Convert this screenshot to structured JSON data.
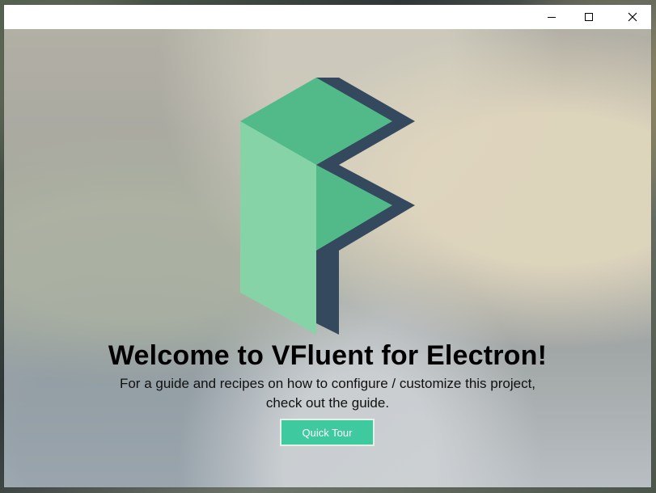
{
  "window": {
    "controls": {
      "minimize": "minimize-icon",
      "maximize": "maximize-icon",
      "close": "close-icon"
    }
  },
  "brand": {
    "logo_icon": "vfluent-logo-icon"
  },
  "main": {
    "headline": "Welcome to VFluent for Electron!",
    "subtitle": "For a guide and recipes on how to configure / customize this project, check out the guide.",
    "cta_label": "Quick Tour"
  },
  "colors": {
    "logo_light": "#86d3a8",
    "logo_mid": "#52ba88",
    "logo_dark": "#34495e",
    "button": "#3fc99e"
  }
}
